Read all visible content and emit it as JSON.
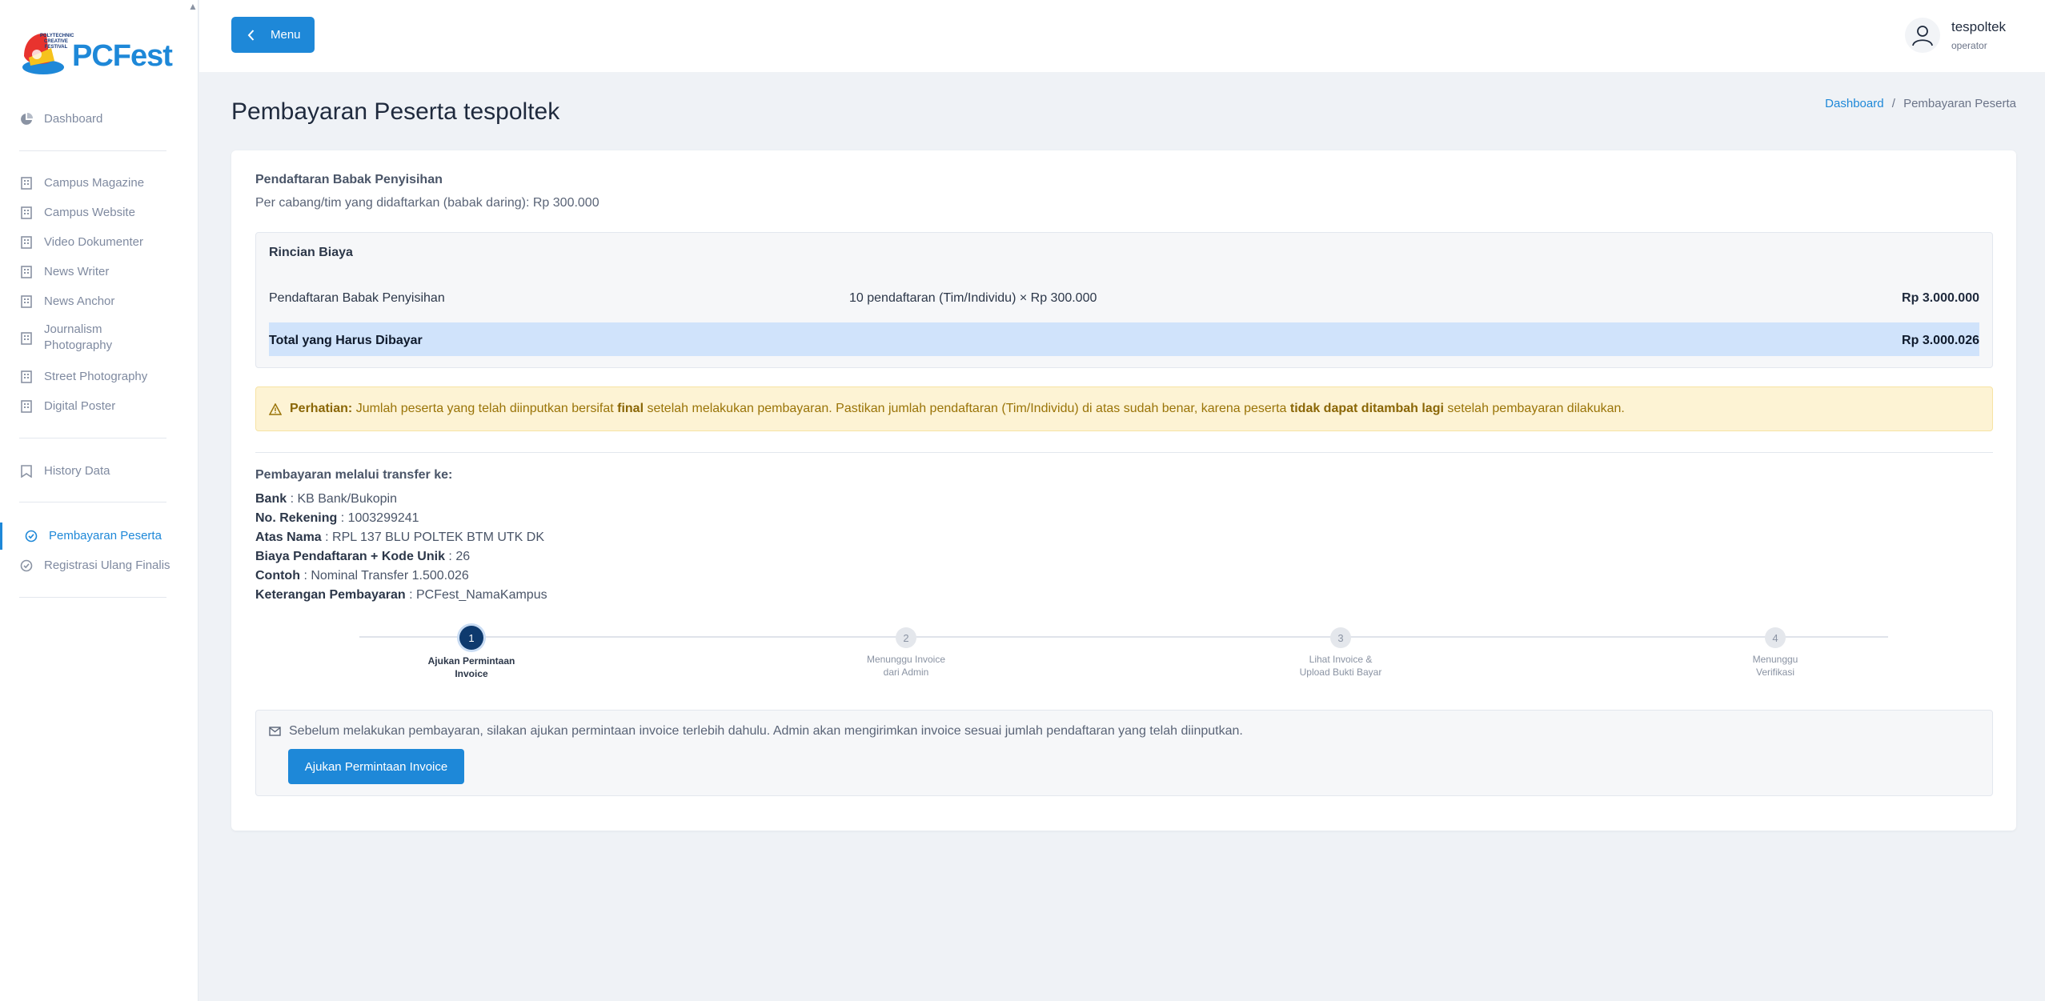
{
  "brand": {
    "name": "PCFest",
    "badge_text": "POLYTECHNIC CREATIVE FESTIVAL",
    "accent": "#1e88d8"
  },
  "sidebar": {
    "items": [
      {
        "label": "Dashboard",
        "icon": "pie-chart-icon"
      },
      {
        "label": "Campus Magazine",
        "icon": "building-icon"
      },
      {
        "label": "Campus Website",
        "icon": "building-icon"
      },
      {
        "label": "Video Dokumenter",
        "icon": "building-icon"
      },
      {
        "label": "News Writer",
        "icon": "building-icon"
      },
      {
        "label": "News Anchor",
        "icon": "building-icon"
      },
      {
        "label": "Journalism Photography",
        "icon": "building-icon"
      },
      {
        "label": "Street Photography",
        "icon": "building-icon"
      },
      {
        "label": "Digital Poster",
        "icon": "building-icon"
      },
      {
        "label": "History Data",
        "icon": "bookmark-icon"
      },
      {
        "label": "Pembayaran Peserta",
        "icon": "check-badge-icon",
        "active": true
      },
      {
        "label": "Registrasi Ulang Finalis",
        "icon": "check-badge-icon"
      }
    ]
  },
  "header": {
    "menu_label": "Menu",
    "user_name": "tespoltek",
    "user_role": "operator"
  },
  "page": {
    "title": "Pembayaran Peserta tespoltek",
    "breadcrumb_home": "Dashboard",
    "breadcrumb_sep": "/",
    "breadcrumb_current": "Pembayaran Peserta"
  },
  "registration": {
    "title": "Pendaftaran Babak Penyisihan",
    "subtitle": "Per cabang/tim yang didaftarkan (babak daring): Rp 300.000"
  },
  "cost": {
    "title": "Rincian Biaya",
    "row_label": "Pendaftaran Babak Penyisihan",
    "row_calc": "10 pendaftaran (Tim/Individu) × Rp 300.000",
    "row_amount": "Rp 3.000.000",
    "total_label": "Total yang Harus Dibayar",
    "total_amount": "Rp 3.000.026"
  },
  "alert": {
    "lead": "Perhatian:",
    "text1": " Jumlah peserta yang telah diinputkan bersifat ",
    "bold1": "final",
    "text2": " setelah melakukan pembayaran. Pastikan jumlah pendaftaran (Tim/Individu) di atas sudah benar, karena peserta ",
    "bold2": "tidak dapat ditambah lagi",
    "text3": " setelah pembayaran dilakukan."
  },
  "transfer": {
    "title": "Pembayaran melalui transfer ke:",
    "rows": [
      {
        "label": "Bank",
        "value": ": KB Bank/Bukopin"
      },
      {
        "label": "No. Rekening",
        "value": ": 1003299241"
      },
      {
        "label": "Atas Nama",
        "value": ": RPL 137 BLU POLTEK BTM UTK DK"
      },
      {
        "label": "Biaya Pendaftaran + Kode Unik",
        "value": ": 26"
      },
      {
        "label": "Contoh",
        "value": ": Nominal Transfer 1.500.026"
      },
      {
        "label": "Keterangan Pembayaran",
        "value": ": PCFest_NamaKampus"
      }
    ]
  },
  "steps": [
    {
      "num": "1",
      "line1": "Ajukan Permintaan",
      "line2": "Invoice",
      "active": true
    },
    {
      "num": "2",
      "line1": "Menunggu Invoice",
      "line2": "dari Admin",
      "active": false
    },
    {
      "num": "3",
      "line1": "Lihat Invoice &",
      "line2": "Upload Bukti Bayar",
      "active": false
    },
    {
      "num": "4",
      "line1": "Menunggu",
      "line2": "Verifikasi",
      "active": false
    }
  ],
  "invoice": {
    "message": "Sebelum melakukan pembayaran, silakan ajukan permintaan invoice terlebih dahulu. Admin akan mengirimkan invoice sesuai jumlah pendaftaran yang telah diinputkan.",
    "button_label": "Ajukan Permintaan Invoice"
  }
}
